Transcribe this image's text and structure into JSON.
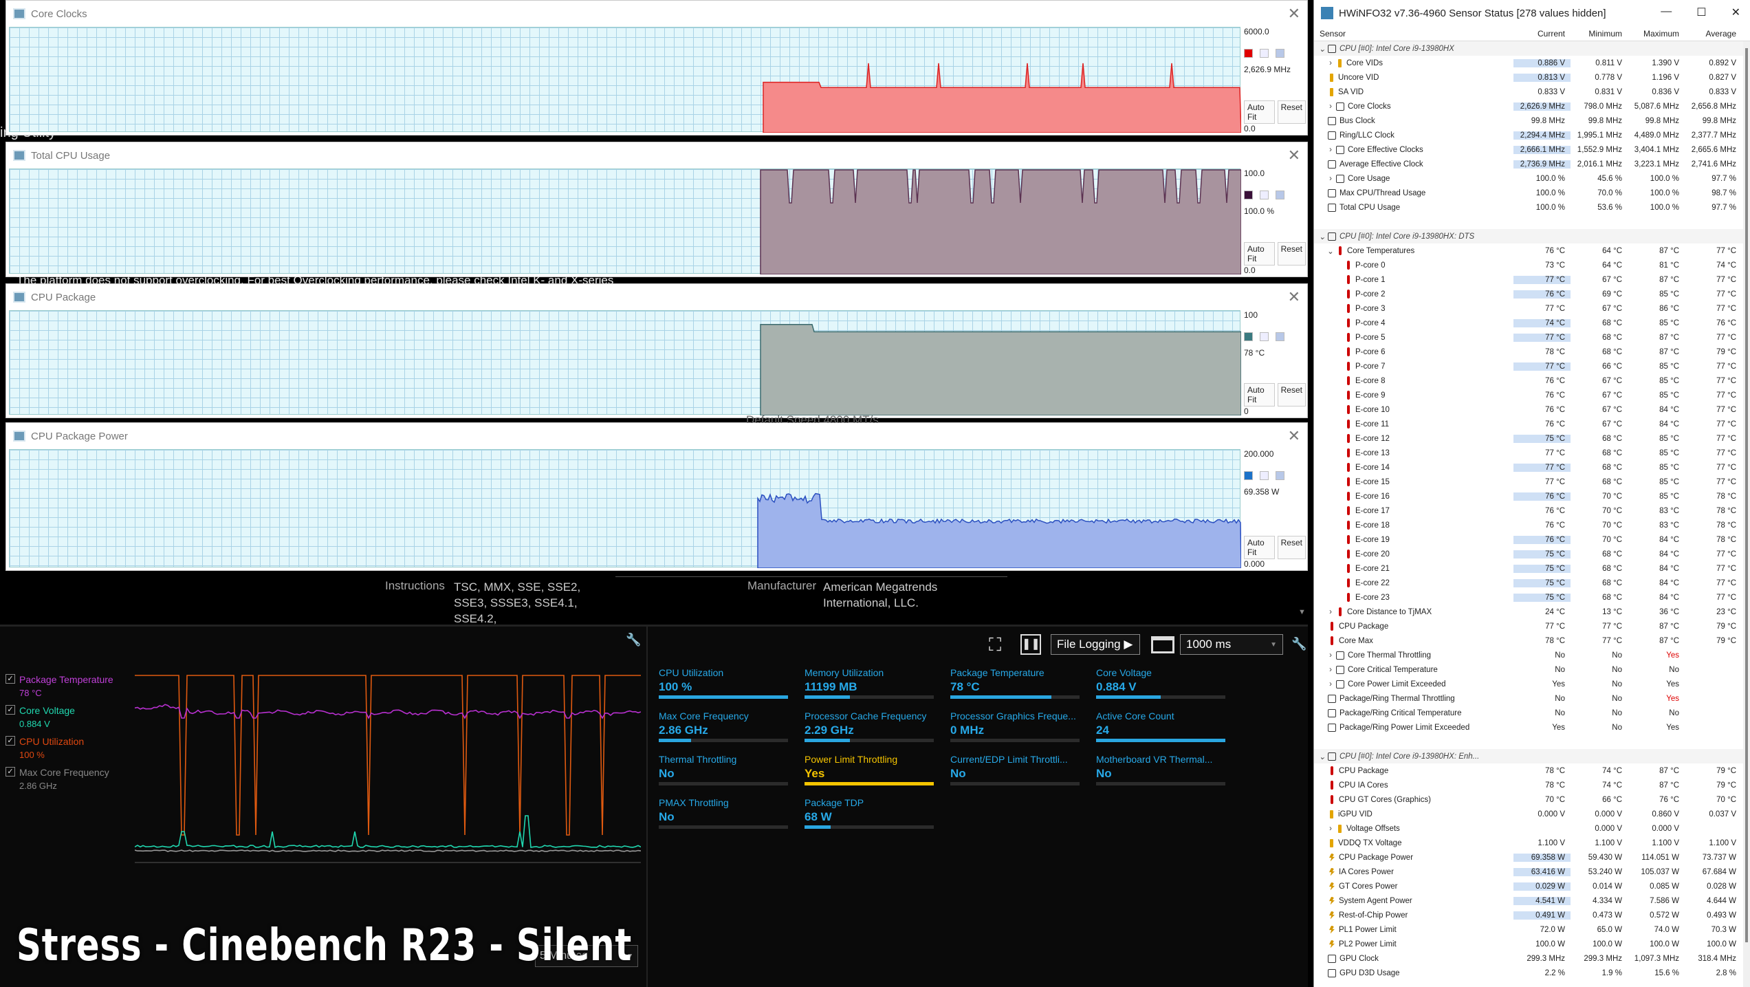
{
  "plots": [
    {
      "title": "Core Clocks",
      "max": "6000.0",
      "cur": "2,626.9 MHz",
      "min": "0.0",
      "color": "#f58a8a",
      "stroke": "#d22",
      "swatch": "#e00000",
      "autofit": "Auto Fit",
      "reset": "Reset"
    },
    {
      "title": "Total CPU Usage",
      "max": "100.0",
      "cur": "100.0 %",
      "min": "0.0",
      "color": "#a8939e",
      "stroke": "#5b3150",
      "swatch": "#3a1038",
      "autofit": "Auto Fit",
      "reset": "Reset"
    },
    {
      "title": "CPU Package",
      "max": "100",
      "cur": "78 °C",
      "min": "0",
      "color": "#a8b2ae",
      "stroke": "#3a6b6f",
      "swatch": "#3a7a80",
      "autofit": "Auto Fit",
      "reset": "Reset"
    },
    {
      "title": "CPU Package Power",
      "max": "200.000",
      "cur": "69.358 W",
      "min": "0.000",
      "color": "#9eb3ec",
      "stroke": "#2a4fc0",
      "swatch": "#1c72c8",
      "autofit": "Auto Fit",
      "reset": "Reset"
    }
  ],
  "overlay": {
    "ly1": "ing Utility",
    "ly2": "The platform does not support overclocking. For best Overclocking performance, please check Intel K- and X-series",
    "ly3": "Default Speed  4800 MT/s",
    "instr_label": "Instructions",
    "instr_val": "TSC, MMX, SSE, SSE2, SSE3, SSSE3, SSE4.1, SSE4.2,",
    "mfr_label": "Manufacturer",
    "mfr_val": "American Megatrends International, LLC."
  },
  "hwinfo": {
    "title": "HWiNFO32 v7.36-4960 Sensor Status [278 values hidden]",
    "cols": [
      "Sensor",
      "Current",
      "Minimum",
      "Maximum",
      "Average"
    ],
    "rows": [
      {
        "t": "grp",
        "a": "v",
        "n": "CPU [#0]: Intel Core i9-13980HX"
      },
      {
        "i": "v",
        "a": ">",
        "n": "Core VIDs",
        "v": [
          "0.886 V",
          "0.811 V",
          "1.390 V",
          "0.892 V"
        ],
        "s": 1,
        "d": 1
      },
      {
        "i": "v",
        "n": "Uncore VID",
        "v": [
          "0.813 V",
          "0.778 V",
          "1.196 V",
          "0.827 V"
        ],
        "s": 1
      },
      {
        "i": "v",
        "n": "SA VID",
        "v": [
          "0.833 V",
          "0.831 V",
          "0.836 V",
          "0.833 V"
        ]
      },
      {
        "i": "o",
        "a": ">",
        "n": "Core Clocks",
        "v": [
          "2,626.9 MHz",
          "798.0 MHz",
          "5,087.6 MHz",
          "2,656.8 MHz"
        ],
        "s": 1,
        "d": 1
      },
      {
        "i": "o",
        "n": "Bus Clock",
        "v": [
          "99.8 MHz",
          "99.8 MHz",
          "99.8 MHz",
          "99.8 MHz"
        ]
      },
      {
        "i": "o",
        "n": "Ring/LLC Clock",
        "v": [
          "2,294.4 MHz",
          "1,995.1 MHz",
          "4,489.0 MHz",
          "2,377.7 MHz"
        ],
        "s": 1
      },
      {
        "i": "o",
        "a": ">",
        "n": "Core Effective Clocks",
        "v": [
          "2,666.1 MHz",
          "1,552.9 MHz",
          "3,404.1 MHz",
          "2,665.6 MHz"
        ],
        "s": 1,
        "d": 1
      },
      {
        "i": "o",
        "n": "Average Effective Clock",
        "v": [
          "2,736.9 MHz",
          "2,016.1 MHz",
          "3,223.1 MHz",
          "2,741.6 MHz"
        ],
        "s": 1
      },
      {
        "i": "o",
        "a": ">",
        "n": "Core Usage",
        "v": [
          "100.0 %",
          "45.6 %",
          "100.0 %",
          "97.7 %"
        ],
        "d": 1
      },
      {
        "i": "o",
        "n": "Max CPU/Thread Usage",
        "v": [
          "100.0 %",
          "70.0 %",
          "100.0 %",
          "98.7 %"
        ]
      },
      {
        "i": "o",
        "n": "Total CPU Usage",
        "v": [
          "100.0 %",
          "53.6 %",
          "100.0 %",
          "97.7 %"
        ]
      },
      {
        "t": "blank"
      },
      {
        "t": "grp",
        "a": "v",
        "n": "CPU [#0]: Intel Core i9-13980HX: DTS"
      },
      {
        "i": "t",
        "a": "v",
        "n": "Core Temperatures",
        "v": [
          "76 °C",
          "64 °C",
          "87 °C",
          "77 °C"
        ],
        "d": 1
      },
      {
        "i": "t",
        "n": "P-core 0",
        "v": [
          "73 °C",
          "64 °C",
          "81 °C",
          "74 °C"
        ],
        "d": 2
      },
      {
        "i": "t",
        "n": "P-core 1",
        "v": [
          "77 °C",
          "67 °C",
          "87 °C",
          "77 °C"
        ],
        "s": 1,
        "d": 2
      },
      {
        "i": "t",
        "n": "P-core 2",
        "v": [
          "76 °C",
          "69 °C",
          "85 °C",
          "77 °C"
        ],
        "s": 1,
        "d": 2
      },
      {
        "i": "t",
        "n": "P-core 3",
        "v": [
          "77 °C",
          "67 °C",
          "86 °C",
          "77 °C"
        ],
        "d": 2
      },
      {
        "i": "t",
        "n": "P-core 4",
        "v": [
          "74 °C",
          "68 °C",
          "85 °C",
          "76 °C"
        ],
        "s": 1,
        "d": 2
      },
      {
        "i": "t",
        "n": "P-core 5",
        "v": [
          "77 °C",
          "68 °C",
          "87 °C",
          "77 °C"
        ],
        "s": 1,
        "d": 2
      },
      {
        "i": "t",
        "n": "P-core 6",
        "v": [
          "78 °C",
          "68 °C",
          "87 °C",
          "79 °C"
        ],
        "d": 2
      },
      {
        "i": "t",
        "n": "P-core 7",
        "v": [
          "77 °C",
          "66 °C",
          "85 °C",
          "77 °C"
        ],
        "s": 1,
        "d": 2
      },
      {
        "i": "t",
        "n": "E-core 8",
        "v": [
          "76 °C",
          "67 °C",
          "85 °C",
          "77 °C"
        ],
        "d": 2
      },
      {
        "i": "t",
        "n": "E-core 9",
        "v": [
          "76 °C",
          "67 °C",
          "85 °C",
          "77 °C"
        ],
        "d": 2
      },
      {
        "i": "t",
        "n": "E-core 10",
        "v": [
          "76 °C",
          "67 °C",
          "84 °C",
          "77 °C"
        ],
        "d": 2
      },
      {
        "i": "t",
        "n": "E-core 11",
        "v": [
          "76 °C",
          "67 °C",
          "84 °C",
          "77 °C"
        ],
        "d": 2
      },
      {
        "i": "t",
        "n": "E-core 12",
        "v": [
          "75 °C",
          "68 °C",
          "85 °C",
          "77 °C"
        ],
        "s": 1,
        "d": 2
      },
      {
        "i": "t",
        "n": "E-core 13",
        "v": [
          "77 °C",
          "68 °C",
          "85 °C",
          "77 °C"
        ],
        "d": 2
      },
      {
        "i": "t",
        "n": "E-core 14",
        "v": [
          "77 °C",
          "68 °C",
          "85 °C",
          "77 °C"
        ],
        "s": 1,
        "d": 2
      },
      {
        "i": "t",
        "n": "E-core 15",
        "v": [
          "77 °C",
          "68 °C",
          "85 °C",
          "77 °C"
        ],
        "d": 2
      },
      {
        "i": "t",
        "n": "E-core 16",
        "v": [
          "76 °C",
          "70 °C",
          "85 °C",
          "78 °C"
        ],
        "s": 1,
        "d": 2
      },
      {
        "i": "t",
        "n": "E-core 17",
        "v": [
          "76 °C",
          "70 °C",
          "83 °C",
          "78 °C"
        ],
        "d": 2
      },
      {
        "i": "t",
        "n": "E-core 18",
        "v": [
          "76 °C",
          "70 °C",
          "83 °C",
          "78 °C"
        ],
        "d": 2
      },
      {
        "i": "t",
        "n": "E-core 19",
        "v": [
          "76 °C",
          "70 °C",
          "84 °C",
          "78 °C"
        ],
        "s": 1,
        "d": 2
      },
      {
        "i": "t",
        "n": "E-core 20",
        "v": [
          "75 °C",
          "68 °C",
          "84 °C",
          "77 °C"
        ],
        "s": 1,
        "d": 2
      },
      {
        "i": "t",
        "n": "E-core 21",
        "v": [
          "75 °C",
          "68 °C",
          "84 °C",
          "77 °C"
        ],
        "s": 1,
        "d": 2
      },
      {
        "i": "t",
        "n": "E-core 22",
        "v": [
          "75 °C",
          "68 °C",
          "84 °C",
          "77 °C"
        ],
        "s": 1,
        "d": 2
      },
      {
        "i": "t",
        "n": "E-core 23",
        "v": [
          "75 °C",
          "68 °C",
          "84 °C",
          "77 °C"
        ],
        "s": 1,
        "d": 2
      },
      {
        "i": "t",
        "a": ">",
        "n": "Core Distance to TjMAX",
        "v": [
          "24 °C",
          "13 °C",
          "36 °C",
          "23 °C"
        ],
        "d": 1
      },
      {
        "i": "t",
        "n": "CPU Package",
        "v": [
          "77 °C",
          "77 °C",
          "87 °C",
          "79 °C"
        ]
      },
      {
        "i": "t",
        "n": "Core Max",
        "v": [
          "78 °C",
          "77 °C",
          "87 °C",
          "79 °C"
        ]
      },
      {
        "i": "o",
        "a": ">",
        "n": "Core Thermal Throttling",
        "v": [
          "No",
          "No",
          "Yes",
          ""
        ],
        "r": 2,
        "d": 1
      },
      {
        "i": "o",
        "a": ">",
        "n": "Core Critical Temperature",
        "v": [
          "No",
          "No",
          "No",
          ""
        ],
        "d": 1
      },
      {
        "i": "o",
        "a": ">",
        "n": "Core Power Limit Exceeded",
        "v": [
          "Yes",
          "No",
          "Yes",
          ""
        ],
        "d": 1
      },
      {
        "i": "o",
        "n": "Package/Ring Thermal Throttling",
        "v": [
          "No",
          "No",
          "Yes",
          ""
        ],
        "r": 2
      },
      {
        "i": "o",
        "n": "Package/Ring Critical Temperature",
        "v": [
          "No",
          "No",
          "No",
          ""
        ]
      },
      {
        "i": "o",
        "n": "Package/Ring Power Limit Exceeded",
        "v": [
          "Yes",
          "No",
          "Yes",
          ""
        ]
      },
      {
        "t": "blank"
      },
      {
        "t": "grp",
        "a": "v",
        "n": "CPU [#0]: Intel Core i9-13980HX: Enh..."
      },
      {
        "i": "t",
        "n": "CPU Package",
        "v": [
          "78 °C",
          "74 °C",
          "87 °C",
          "79 °C"
        ]
      },
      {
        "i": "t",
        "n": "CPU IA Cores",
        "v": [
          "78 °C",
          "74 °C",
          "87 °C",
          "79 °C"
        ]
      },
      {
        "i": "t",
        "n": "CPU GT Cores (Graphics)",
        "v": [
          "70 °C",
          "66 °C",
          "76 °C",
          "70 °C"
        ]
      },
      {
        "i": "v",
        "n": "iGPU VID",
        "v": [
          "0.000 V",
          "0.000 V",
          "0.860 V",
          "0.037 V"
        ]
      },
      {
        "i": "v",
        "a": ">",
        "n": "Voltage Offsets",
        "v": [
          "",
          "0.000 V",
          "0.000 V",
          ""
        ],
        "d": 1
      },
      {
        "i": "v",
        "n": "VDDQ TX Voltage",
        "v": [
          "1.100 V",
          "1.100 V",
          "1.100 V",
          "1.100 V"
        ]
      },
      {
        "i": "p",
        "n": "CPU Package Power",
        "v": [
          "69.358 W",
          "59.430 W",
          "114.051 W",
          "73.737 W"
        ],
        "s": 1
      },
      {
        "i": "p",
        "n": "IA Cores Power",
        "v": [
          "63.416 W",
          "53.240 W",
          "105.037 W",
          "67.684 W"
        ],
        "s": 1
      },
      {
        "i": "p",
        "n": "GT Cores Power",
        "v": [
          "0.029 W",
          "0.014 W",
          "0.085 W",
          "0.028 W"
        ],
        "s": 1
      },
      {
        "i": "p",
        "n": "System Agent Power",
        "v": [
          "4.541 W",
          "4.334 W",
          "7.586 W",
          "4.644 W"
        ],
        "s": 1
      },
      {
        "i": "p",
        "n": "Rest-of-Chip Power",
        "v": [
          "0.491 W",
          "0.473 W",
          "0.572 W",
          "0.493 W"
        ],
        "s": 1
      },
      {
        "i": "p",
        "n": "PL1 Power Limit",
        "v": [
          "72.0 W",
          "65.0 W",
          "74.0 W",
          "70.3 W"
        ]
      },
      {
        "i": "p",
        "n": "PL2 Power Limit",
        "v": [
          "100.0 W",
          "100.0 W",
          "100.0 W",
          "100.0 W"
        ]
      },
      {
        "i": "o",
        "n": "GPU Clock",
        "v": [
          "299.3 MHz",
          "299.3 MHz",
          "1,097.3 MHz",
          "318.4 MHz"
        ]
      },
      {
        "i": "o",
        "n": "GPU D3D Usage",
        "v": [
          "2.2 %",
          "1.9 %",
          "15.6 %",
          "2.8 %"
        ]
      }
    ]
  },
  "xtu": {
    "legend": [
      {
        "label": "Package Temperature",
        "value": "78 °C",
        "color": "#c040d8"
      },
      {
        "label": "Core Voltage",
        "value": "0.884 V",
        "color": "#20d8b0"
      },
      {
        "label": "CPU Utilization",
        "value": "100 %",
        "color": "#e04810"
      },
      {
        "label": "Max Core Frequency",
        "value": "2.86 GHz",
        "color": "#888888"
      }
    ],
    "file_logging": "File Logging ▶",
    "interval": "1000 ms",
    "duration": "5 Minutes",
    "metrics": [
      {
        "l": "CPU Utilization",
        "v": "100 %",
        "f": 1
      },
      {
        "l": "Memory Utilization",
        "v": "11199  MB",
        "f": 0.35
      },
      {
        "l": "Package Temperature",
        "v": "78 °C",
        "f": 0.78
      },
      {
        "l": "Core Voltage",
        "v": "0.884 V",
        "f": 0.5
      },
      {
        "l": "Max Core Frequency",
        "v": "2.86 GHz",
        "f": 0.25
      },
      {
        "l": "Processor Cache Frequency",
        "v": "2.29 GHz",
        "f": 0.35
      },
      {
        "l": "Processor Graphics Freque...",
        "v": "0 MHz",
        "f": 0
      },
      {
        "l": "Active Core Count",
        "v": "24",
        "f": 1
      },
      {
        "l": "Thermal Throttling",
        "v": "No",
        "f": 0
      },
      {
        "l": "Power Limit Throttling",
        "v": "Yes",
        "f": 1,
        "y": 1
      },
      {
        "l": "Current/EDP Limit Throttli...",
        "v": "No",
        "f": 0
      },
      {
        "l": "Motherboard VR Thermal...",
        "v": "No",
        "f": 0
      },
      {
        "l": "PMAX Throttling",
        "v": "No",
        "f": 0
      },
      {
        "l": "Package TDP",
        "v": "68 W",
        "f": 0.2
      }
    ]
  },
  "caption": "Stress - Cinebench R23 - Silent"
}
